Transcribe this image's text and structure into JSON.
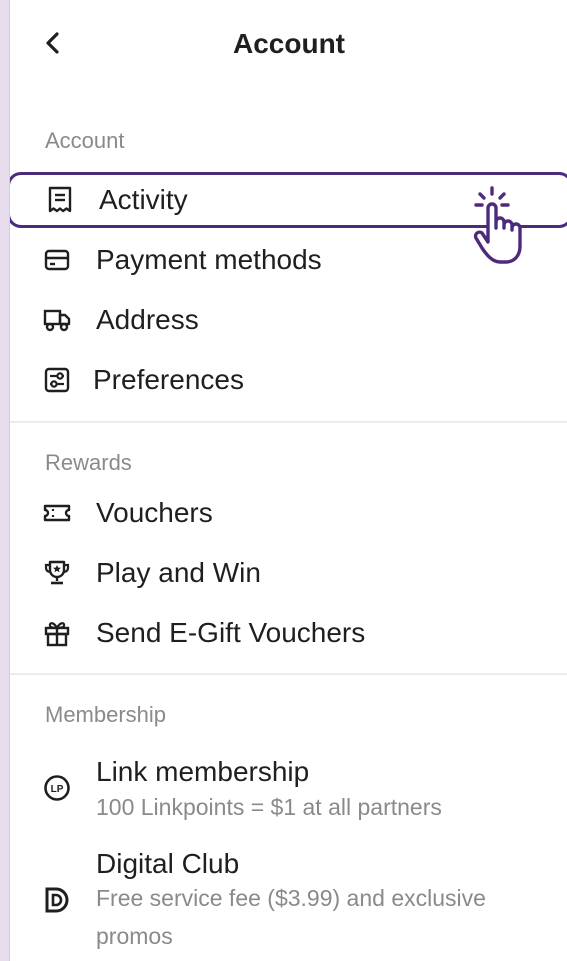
{
  "header": {
    "title": "Account",
    "back_icon": "chevron-left-icon"
  },
  "sections": {
    "account": {
      "label": "Account",
      "items": [
        {
          "label": "Activity",
          "icon": "receipt-icon"
        },
        {
          "label": "Payment methods",
          "icon": "credit-card-icon"
        },
        {
          "label": "Address",
          "icon": "truck-icon"
        },
        {
          "label": "Preferences",
          "icon": "sliders-icon"
        }
      ]
    },
    "rewards": {
      "label": "Rewards",
      "items": [
        {
          "label": "Vouchers",
          "icon": "ticket-icon"
        },
        {
          "label": "Play and Win",
          "icon": "trophy-icon"
        },
        {
          "label": "Send E-Gift Vouchers",
          "icon": "gift-icon"
        }
      ]
    },
    "membership": {
      "label": "Membership",
      "items": [
        {
          "title": "Link membership",
          "subtitle": "100 Linkpoints = $1 at all partners",
          "icon": "linkpoints-icon"
        },
        {
          "title": "Digital Club",
          "subtitle": "Free service fee ($3.99) and exclusive promos",
          "icon": "digital-club-icon"
        }
      ]
    }
  },
  "colors": {
    "highlight": "#4c2a7c",
    "text": "#1f1f1f",
    "muted": "#8a8a8a"
  }
}
